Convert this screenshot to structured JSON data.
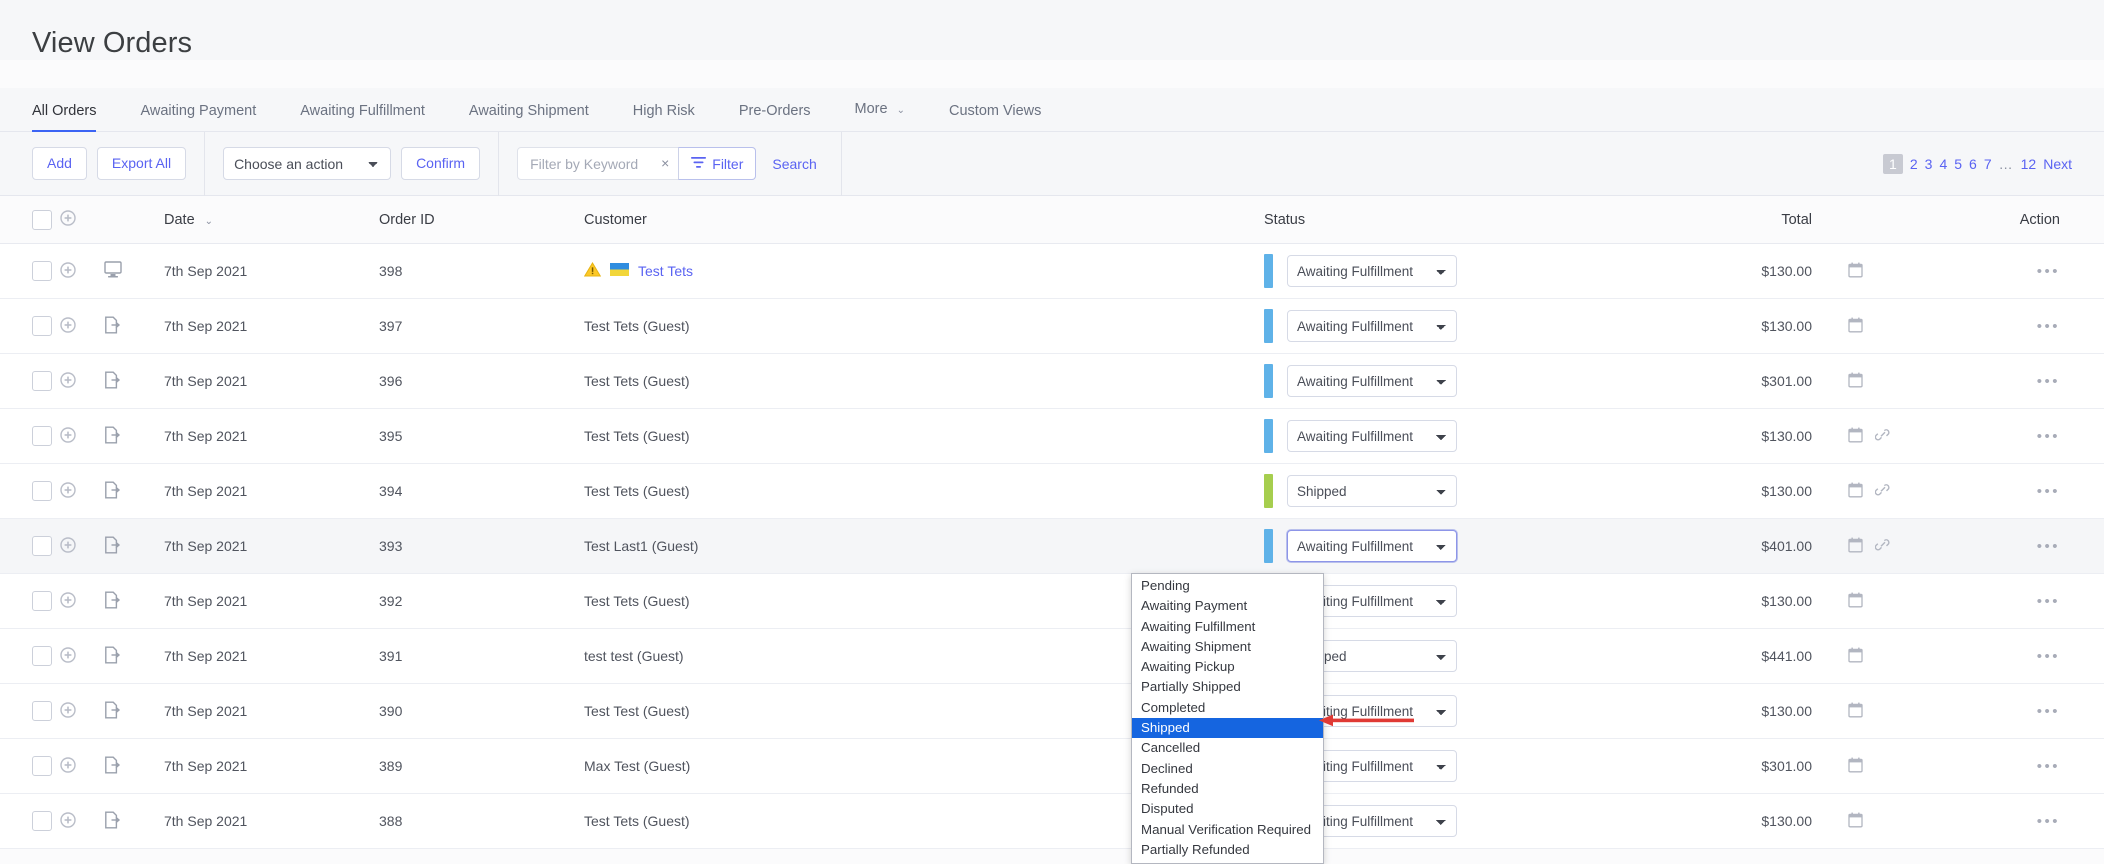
{
  "header": {
    "title": "View Orders"
  },
  "tabs": [
    {
      "label": "All Orders",
      "active": true
    },
    {
      "label": "Awaiting Payment",
      "active": false
    },
    {
      "label": "Awaiting Fulfillment",
      "active": false
    },
    {
      "label": "Awaiting Shipment",
      "active": false
    },
    {
      "label": "High Risk",
      "active": false
    },
    {
      "label": "Pre-Orders",
      "active": false
    },
    {
      "label": "More",
      "active": false,
      "caret": "⌄"
    },
    {
      "label": "Custom Views",
      "active": false
    }
  ],
  "toolbar": {
    "add_label": "Add",
    "export_label": "Export All",
    "action_select_value": "Choose an action",
    "action_options": [
      "Choose an action"
    ],
    "confirm_label": "Confirm",
    "keyword_placeholder": "Filter by Keyword",
    "keyword_value": "",
    "clear_label": "×",
    "filter_label": "Filter",
    "search_label": "Search"
  },
  "pagination": {
    "current": "1",
    "pages": [
      "2",
      "3",
      "4",
      "5",
      "6",
      "7"
    ],
    "ellipsis": "…",
    "last": "12",
    "next_label": "Next"
  },
  "table": {
    "columns": {
      "date": "Date",
      "order_id": "Order ID",
      "customer": "Customer",
      "status": "Status",
      "total": "Total",
      "action": "Action"
    },
    "sort_caret": "⌄",
    "rows": [
      {
        "date": "7th Sep 2021",
        "order_id": "398",
        "customer": "Test Tets",
        "customer_is_link": true,
        "warning": true,
        "flag": true,
        "type_icon": "desktop-icon",
        "status": "Awaiting Fulfillment",
        "status_color": "#5fb2e8",
        "total": "$130.00",
        "has_calendar": true,
        "has_link": false,
        "highlight": false,
        "dropdown_open": false
      },
      {
        "date": "7th Sep 2021",
        "order_id": "397",
        "customer": "Test Tets (Guest)",
        "customer_is_link": false,
        "warning": false,
        "flag": false,
        "type_icon": "manual-order-icon",
        "status": "Awaiting Fulfillment",
        "status_color": "#5fb2e8",
        "total": "$130.00",
        "has_calendar": true,
        "has_link": false,
        "highlight": false,
        "dropdown_open": false
      },
      {
        "date": "7th Sep 2021",
        "order_id": "396",
        "customer": "Test Tets (Guest)",
        "customer_is_link": false,
        "warning": false,
        "flag": false,
        "type_icon": "manual-order-icon",
        "status": "Awaiting Fulfillment",
        "status_color": "#5fb2e8",
        "total": "$301.00",
        "has_calendar": true,
        "has_link": false,
        "highlight": false,
        "dropdown_open": false
      },
      {
        "date": "7th Sep 2021",
        "order_id": "395",
        "customer": "Test Tets (Guest)",
        "customer_is_link": false,
        "warning": false,
        "flag": false,
        "type_icon": "manual-order-icon",
        "status": "Awaiting Fulfillment",
        "status_color": "#5fb2e8",
        "total": "$130.00",
        "has_calendar": true,
        "has_link": true,
        "highlight": false,
        "dropdown_open": false
      },
      {
        "date": "7th Sep 2021",
        "order_id": "394",
        "customer": "Test Tets (Guest)",
        "customer_is_link": false,
        "warning": false,
        "flag": false,
        "type_icon": "manual-order-icon",
        "status": "Shipped",
        "status_color": "#a6ce4e",
        "total": "$130.00",
        "has_calendar": true,
        "has_link": true,
        "highlight": false,
        "dropdown_open": false
      },
      {
        "date": "7th Sep 2021",
        "order_id": "393",
        "customer": "Test Last1 (Guest)",
        "customer_is_link": false,
        "warning": false,
        "flag": false,
        "type_icon": "manual-order-icon",
        "status": "Awaiting Fulfillment",
        "status_color": "#5fb2e8",
        "total": "$401.00",
        "has_calendar": true,
        "has_link": true,
        "highlight": true,
        "dropdown_open": true
      },
      {
        "date": "7th Sep 2021",
        "order_id": "392",
        "customer": "Test Tets (Guest)",
        "customer_is_link": false,
        "warning": false,
        "flag": false,
        "type_icon": "manual-order-icon",
        "status": "Awaiting Fulfillment",
        "status_color": "#5fb2e8",
        "total": "$130.00",
        "has_calendar": true,
        "has_link": false,
        "highlight": false,
        "dropdown_open": false
      },
      {
        "date": "7th Sep 2021",
        "order_id": "391",
        "customer": "test test (Guest)",
        "customer_is_link": false,
        "warning": false,
        "flag": false,
        "type_icon": "manual-order-icon",
        "status": "Shipped",
        "status_color": "#a6ce4e",
        "total": "$441.00",
        "has_calendar": true,
        "has_link": false,
        "highlight": false,
        "dropdown_open": false
      },
      {
        "date": "7th Sep 2021",
        "order_id": "390",
        "customer": "Test Test (Guest)",
        "customer_is_link": false,
        "warning": false,
        "flag": false,
        "type_icon": "manual-order-icon",
        "status": "Awaiting Fulfillment",
        "status_color": "#5fb2e8",
        "total": "$130.00",
        "has_calendar": true,
        "has_link": false,
        "highlight": false,
        "dropdown_open": false
      },
      {
        "date": "7th Sep 2021",
        "order_id": "389",
        "customer": "Max Test (Guest)",
        "customer_is_link": false,
        "warning": false,
        "flag": false,
        "type_icon": "manual-order-icon",
        "status": "Awaiting Fulfillment",
        "status_color": "#5fb2e8",
        "total": "$301.00",
        "has_calendar": true,
        "has_link": false,
        "highlight": false,
        "dropdown_open": false
      },
      {
        "date": "7th Sep 2021",
        "order_id": "388",
        "customer": "Test Tets (Guest)",
        "customer_is_link": false,
        "warning": false,
        "flag": false,
        "type_icon": "manual-order-icon",
        "status": "Awaiting Fulfillment",
        "status_color": "#5fb2e8",
        "total": "$130.00",
        "has_calendar": true,
        "has_link": false,
        "highlight": false,
        "dropdown_open": false
      }
    ],
    "row_action_dots": "•••"
  },
  "status_dropdown": {
    "selected": "Shipped",
    "options": [
      "Pending",
      "Awaiting Payment",
      "Awaiting Fulfillment",
      "Awaiting Shipment",
      "Awaiting Pickup",
      "Partially Shipped",
      "Completed",
      "Shipped",
      "Cancelled",
      "Declined",
      "Refunded",
      "Disputed",
      "Manual Verification Required",
      "Partially Refunded"
    ]
  },
  "annotation": {
    "arrow_color": "#e03a35"
  },
  "colors": {
    "accent": "#5a63f2",
    "tab_underline": "#3c64f4",
    "status_blue": "#5fb2e8",
    "status_green": "#a6ce4e",
    "dropdown_selected": "#1565e0"
  }
}
